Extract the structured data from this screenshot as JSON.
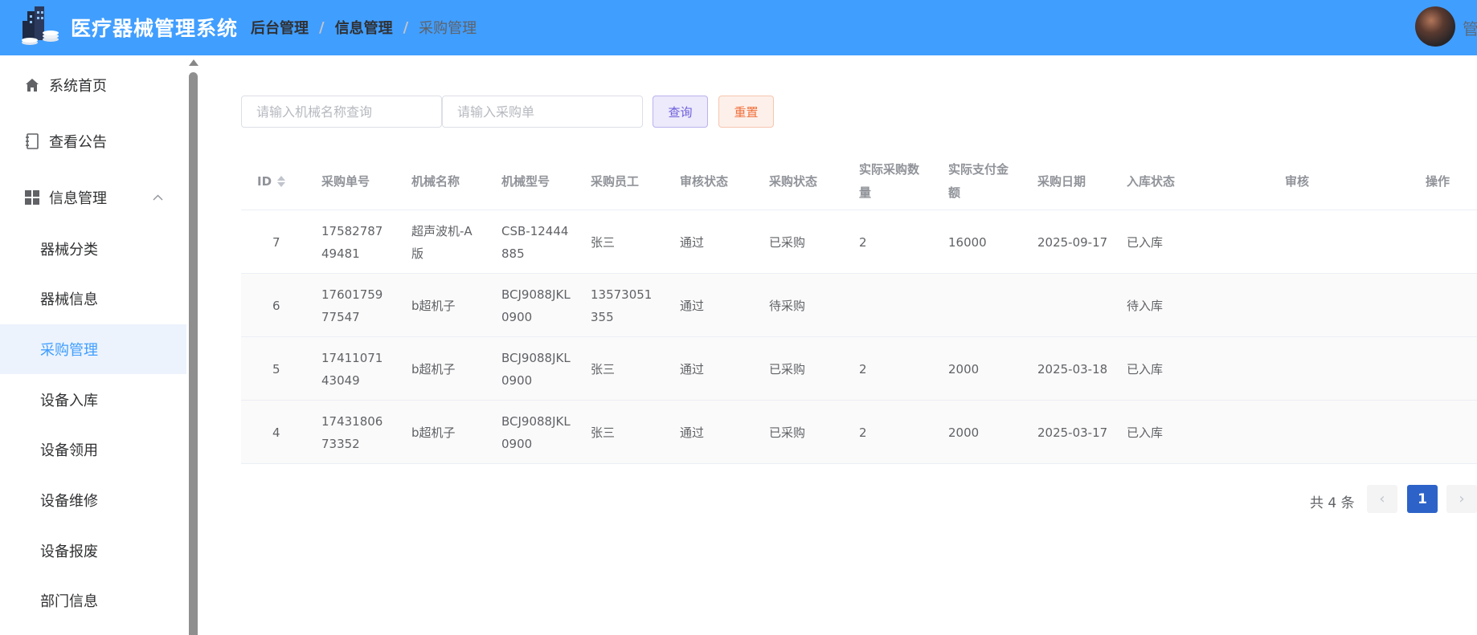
{
  "header": {
    "app_title": "医疗器械管理系统",
    "breadcrumb": [
      "后台管理",
      "信息管理",
      "采购管理"
    ],
    "user_name": "管"
  },
  "sidebar": {
    "items": [
      {
        "label": "系统首页",
        "icon": "home-icon"
      },
      {
        "label": "查看公告",
        "icon": "notebook-icon"
      },
      {
        "label": "信息管理",
        "icon": "grid-icon",
        "expanded": true
      }
    ],
    "sub_items": [
      "器械分类",
      "器械信息",
      "采购管理",
      "设备入库",
      "设备领用",
      "设备维修",
      "设备报废",
      "部门信息"
    ],
    "active_sub_item": "采购管理"
  },
  "search": {
    "name_placeholder": "请输入机械名称查询",
    "order_placeholder": "请输入采购单",
    "query_label": "查询",
    "reset_label": "重置"
  },
  "table": {
    "columns": [
      "ID",
      "采购单号",
      "机械名称",
      "机械型号",
      "采购员工",
      "审核状态",
      "采购状态",
      "实际采购数量",
      "实际支付金额",
      "采购日期",
      "入库状态",
      "审核",
      "操作"
    ],
    "rows": [
      {
        "id": "7",
        "order_no": "1758278749481",
        "name": "超声波机-A版",
        "model": "CSB-12444885",
        "staff": "张三",
        "audit": "通过",
        "purchase": "已采购",
        "qty": "2",
        "amount": "16000",
        "date": "2025-09-17",
        "stock": "已入库"
      },
      {
        "id": "6",
        "order_no": "1760175977547",
        "name": "b超机子",
        "model": "BCJ9088JKL0900",
        "staff": "13573051355",
        "audit": "通过",
        "purchase": "待采购",
        "qty": "",
        "amount": "",
        "date": "",
        "stock": "待入库"
      },
      {
        "id": "5",
        "order_no": "1741107143049",
        "name": "b超机子",
        "model": "BCJ9088JKL0900",
        "staff": "张三",
        "audit": "通过",
        "purchase": "已采购",
        "qty": "2",
        "amount": "2000",
        "date": "2025-03-18",
        "stock": "已入库"
      },
      {
        "id": "4",
        "order_no": "1743180673352",
        "name": "b超机子",
        "model": "BCJ9088JKL0900",
        "staff": "张三",
        "audit": "通过",
        "purchase": "已采购",
        "qty": "2",
        "amount": "2000",
        "date": "2025-03-17",
        "stock": "已入库"
      }
    ]
  },
  "pagination": {
    "total_text": "共 4 条",
    "current_page": "1"
  },
  "colors": {
    "header_bg": "#409eff",
    "active_item": "#409eff",
    "page_active": "#2d63c8"
  }
}
